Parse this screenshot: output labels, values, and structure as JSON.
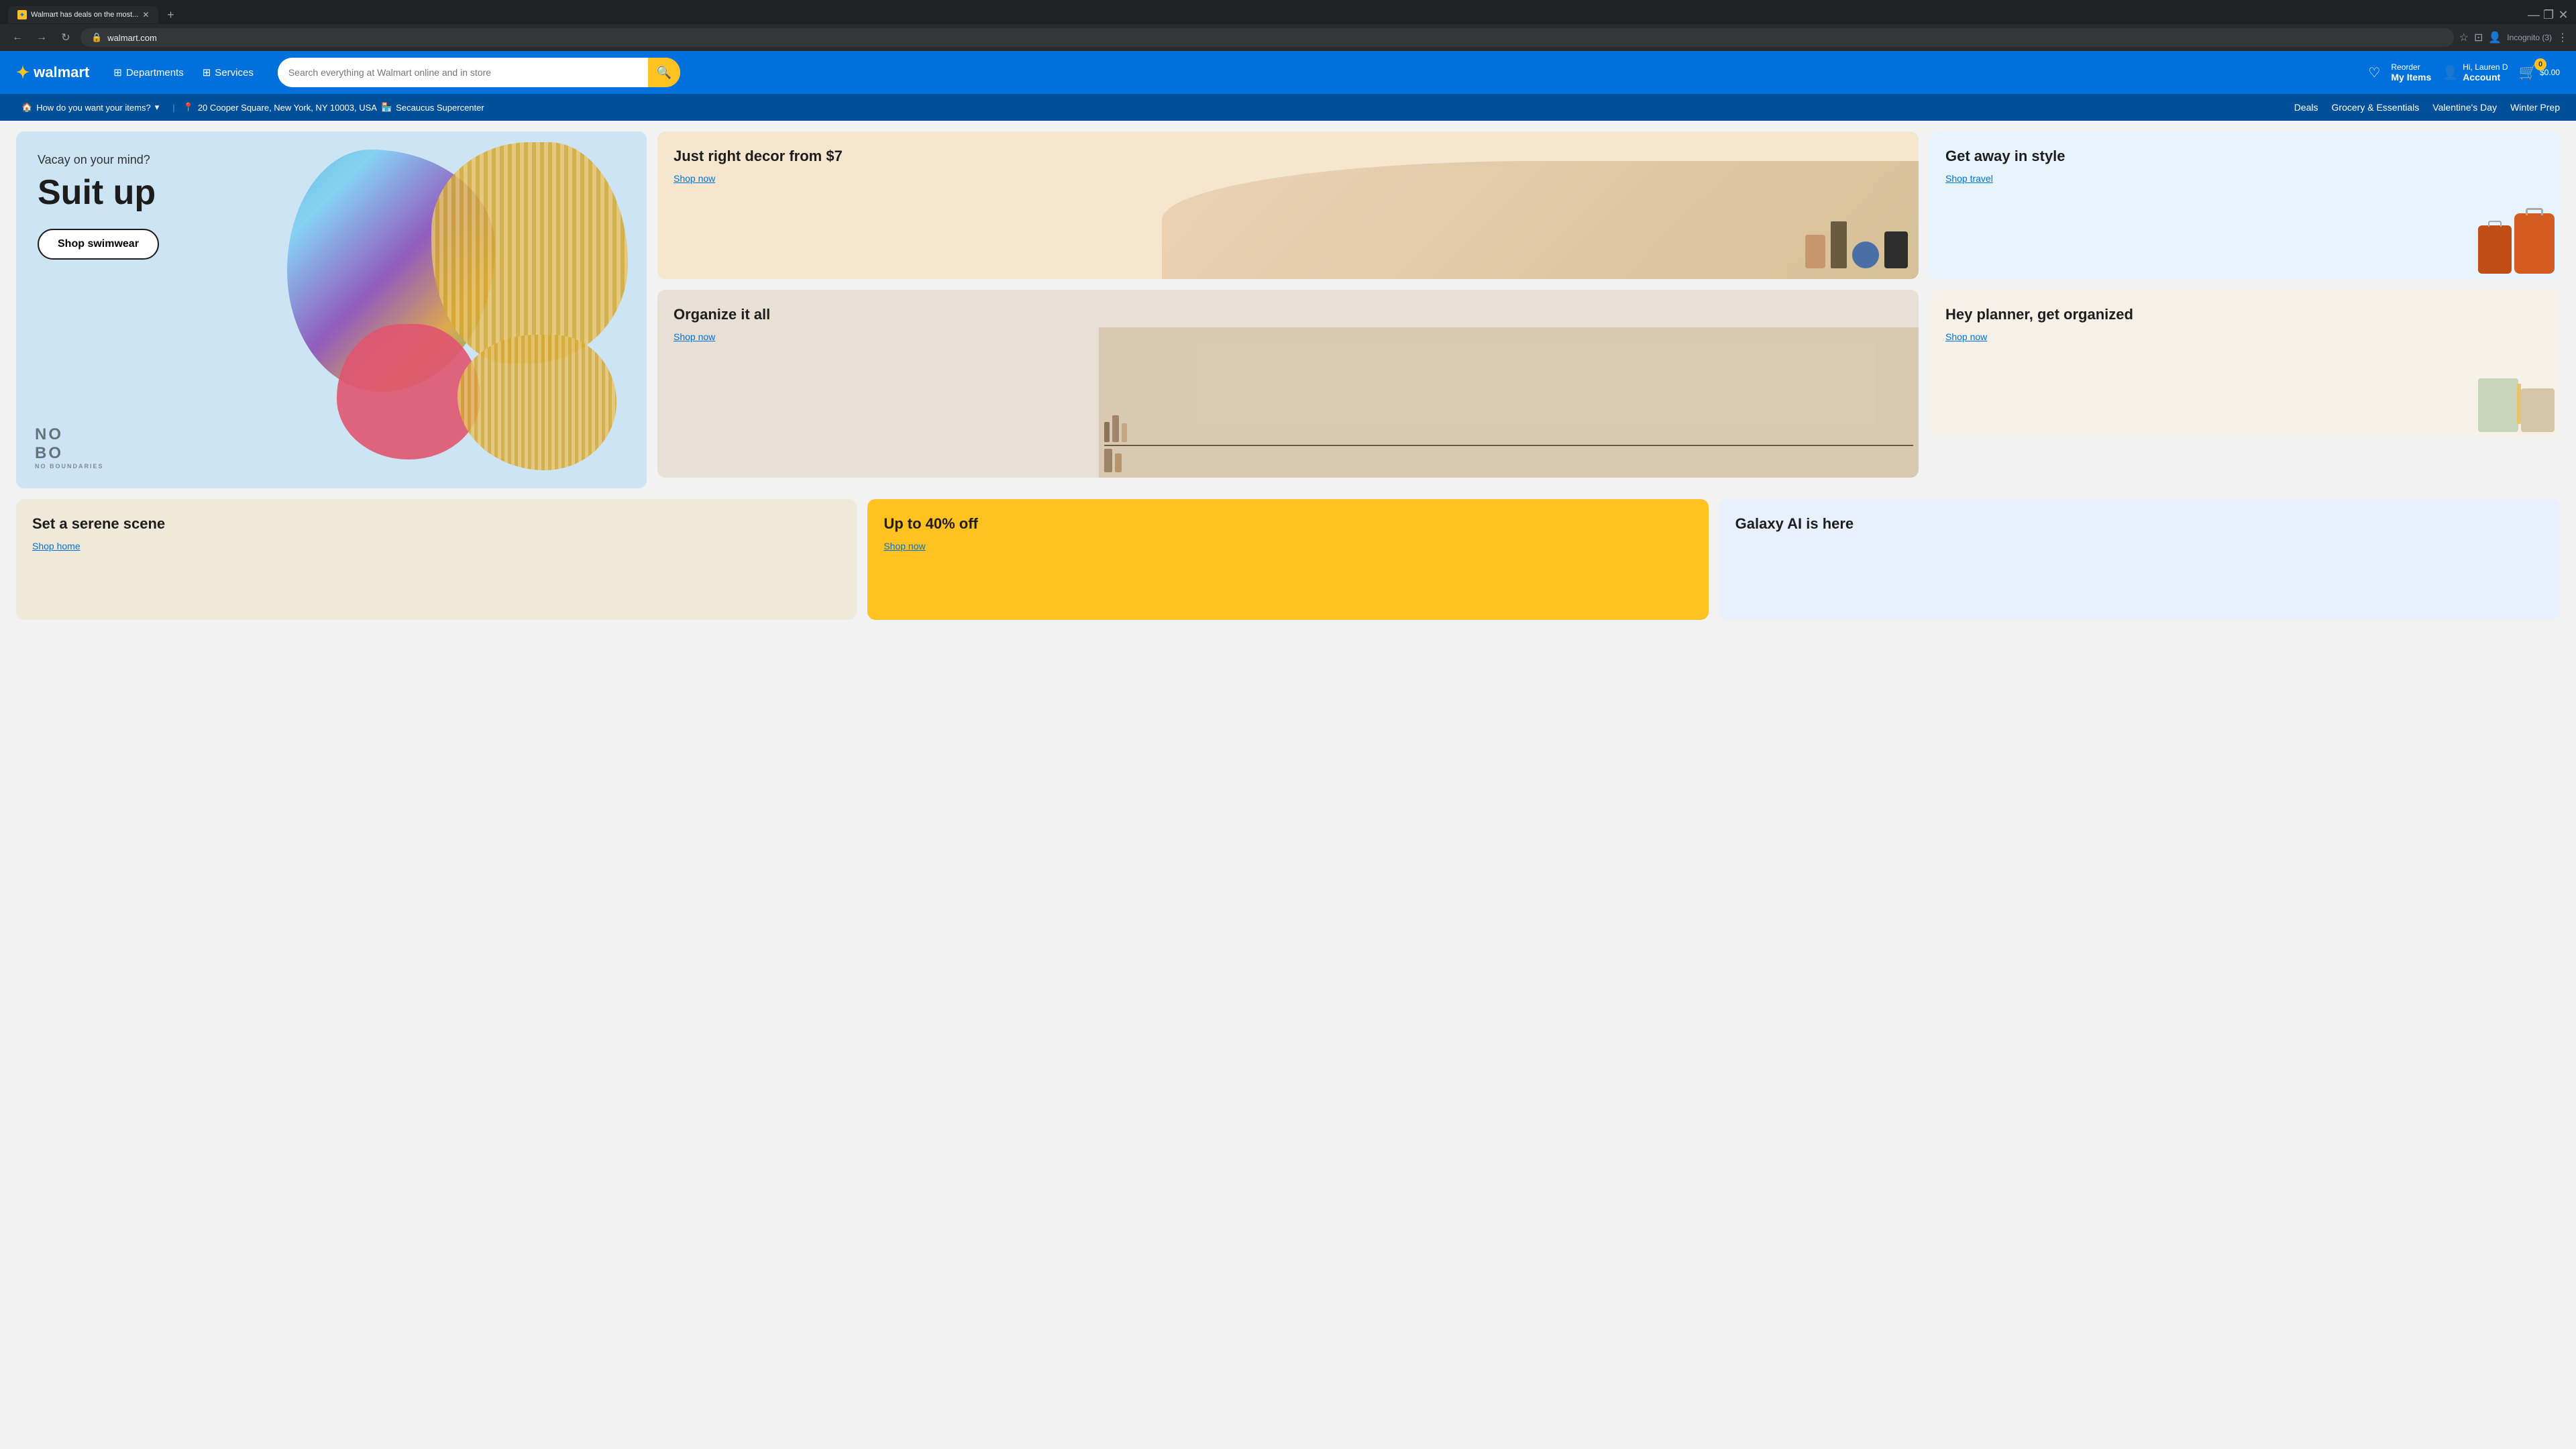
{
  "browser": {
    "tab": {
      "title": "Walmart has deals on the most...",
      "favicon": "W"
    },
    "address": "walmart.com",
    "incognito_label": "Incognito (3)"
  },
  "header": {
    "logo_text": "walmart",
    "departments_label": "Departments",
    "services_label": "Services",
    "search_placeholder": "Search everything at Walmart online and in store",
    "reorder_label": "Reorder",
    "my_items_label": "My Items",
    "account_greeting": "Hi, Lauren D",
    "account_label": "Account",
    "cart_count": "0",
    "cart_price": "$0.00"
  },
  "subnav": {
    "delivery_label": "How do you want your items?",
    "address": "20 Cooper Square, New York, NY 10003, USA",
    "store": "Secaucus Supercenter",
    "links": [
      "Deals",
      "Grocery & Essentials",
      "Valentine's Day",
      "Winter Prep"
    ]
  },
  "main": {
    "card_decor": {
      "title": "Just right decor from $7",
      "link": "Shop now"
    },
    "card_organize": {
      "title": "Organize it all",
      "link": "Shop now"
    },
    "hero": {
      "eyebrow": "Vacay on your mind?",
      "title": "Suit up",
      "cta": "Shop swimwear",
      "brand": "NO BO"
    },
    "card_travel": {
      "title": "Get away in style",
      "link": "Shop travel"
    },
    "card_planner": {
      "title": "Hey planner, get organized",
      "link": "Shop now"
    },
    "card_serene": {
      "title": "Set a serene scene",
      "link": "Shop home"
    },
    "card_discount": {
      "title": "Up to 40% off",
      "link": "Shop now"
    },
    "card_galaxy": {
      "title": "Galaxy AI is here"
    }
  }
}
